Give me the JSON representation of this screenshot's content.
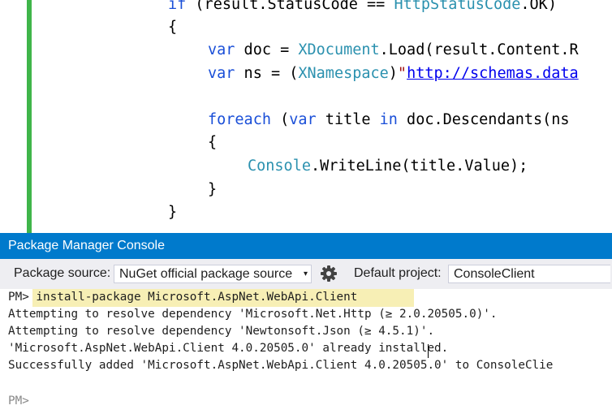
{
  "editor": {
    "lines": [
      {
        "tokens": [
          {
            "c": "kw",
            "t": "if"
          },
          {
            "c": "",
            "t": " (result.StatusCode == "
          },
          {
            "c": "typ",
            "t": "HttpStatusCode"
          },
          {
            "c": "",
            "t": ".OK)"
          }
        ]
      },
      {
        "tokens": [
          {
            "c": "",
            "t": "{"
          }
        ]
      },
      {
        "tokens": [
          {
            "c": "kw",
            "t": "var"
          },
          {
            "c": "",
            "t": " doc = "
          },
          {
            "c": "typ",
            "t": "XDocument"
          },
          {
            "c": "",
            "t": ".Load(result.Content.R"
          }
        ]
      },
      {
        "tokens": [
          {
            "c": "kw",
            "t": "var"
          },
          {
            "c": "",
            "t": " ns = ("
          },
          {
            "c": "typ",
            "t": "XNamespace"
          },
          {
            "c": "",
            "t": ")"
          },
          {
            "c": "str",
            "t": "\""
          },
          {
            "c": "url",
            "t": "http://schemas.data"
          }
        ]
      },
      {
        "tokens": [
          {
            "c": "",
            "t": ""
          }
        ]
      },
      {
        "tokens": [
          {
            "c": "kw",
            "t": "foreach"
          },
          {
            "c": "",
            "t": " ("
          },
          {
            "c": "kw",
            "t": "var"
          },
          {
            "c": "",
            "t": " title "
          },
          {
            "c": "kw",
            "t": "in"
          },
          {
            "c": "",
            "t": " doc.Descendants(ns"
          }
        ]
      },
      {
        "tokens": [
          {
            "c": "",
            "t": "{"
          }
        ]
      },
      {
        "tokens": [
          {
            "c": "typ",
            "t": "Console"
          },
          {
            "c": "",
            "t": ".WriteLine(title.Value);"
          }
        ]
      },
      {
        "tokens": [
          {
            "c": "",
            "t": "}"
          }
        ]
      },
      {
        "tokens": [
          {
            "c": "",
            "t": "}"
          }
        ]
      }
    ]
  },
  "console": {
    "title": "Package Manager Console",
    "source_label": "Package source:",
    "source_value": "NuGet official package source",
    "dropdown_arrow": "▾",
    "settings_icon": "gear-icon",
    "project_label": "Default project:",
    "project_value": "ConsoleClient",
    "prompt": "PM>",
    "command": " install-package Microsoft.AspNet.WebApi.Client",
    "output": [
      "Attempting to resolve dependency 'Microsoft.Net.Http (≥ 2.0.20505.0)'.",
      "Attempting to resolve dependency 'Newtonsoft.Json (≥ 4.5.1)'.",
      "'Microsoft.AspNet.WebApi.Client 4.0.20505.0' already installed.",
      "Successfully added 'Microsoft.AspNet.WebApi.Client 4.0.20505.0' to ConsoleClie"
    ],
    "final_prompt": "PM>"
  },
  "colors": {
    "accent": "#007acc",
    "gutter_green": "#3fb54a",
    "keyword": "#1a4fd8",
    "type": "#2b91af"
  }
}
